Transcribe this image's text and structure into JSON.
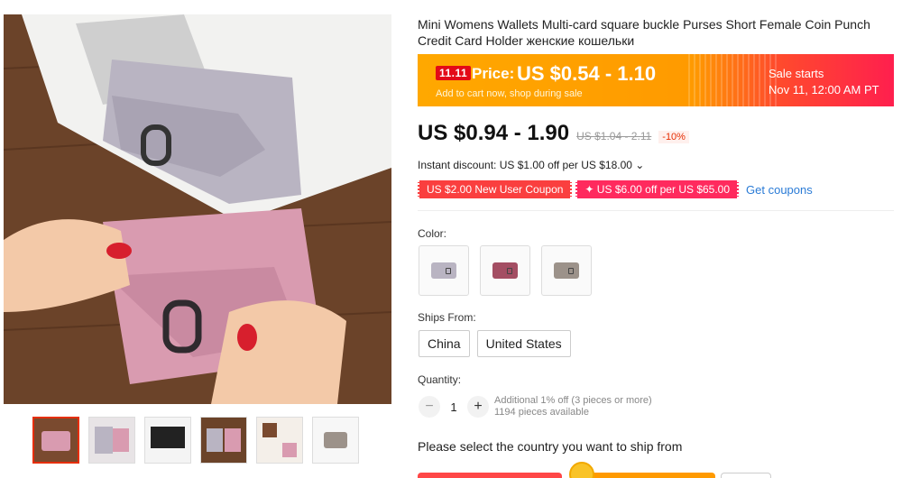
{
  "product": {
    "title": "Mini Womens Wallets Multi-card square buckle Purses Short Female Coin Punch Credit Card Holder женские кошельки"
  },
  "sale_banner": {
    "badge": "11.11",
    "price_label": "Price:",
    "price": "US $0.54 - 1.10",
    "subtext": "Add to cart now, shop during sale",
    "starts_label": "Sale starts",
    "starts_time": "Nov 11, 12:00 AM PT"
  },
  "pricing": {
    "price": "US $0.94 - 1.90",
    "old_price": "US $1.04 - 2.11",
    "discount": "-10%"
  },
  "instant_discount": "Instant discount: US $1.00 off per US $18.00 ⌄",
  "coupons": {
    "new_user": "US $2.00 New User Coupon",
    "off": "✦ US $6.00 off per US $65.00",
    "get": "Get coupons"
  },
  "color": {
    "label": "Color:",
    "options": [
      "gray-icon",
      "rose-icon",
      "taupe-icon"
    ]
  },
  "ships_from": {
    "label": "Ships From:",
    "options": [
      "China",
      "United States"
    ]
  },
  "quantity": {
    "label": "Quantity:",
    "value": "1",
    "note_line1": "Additional 1% off (3 pieces or more)",
    "note_line2": "1194 pieces available"
  },
  "ship_country": "Please select the country you want to ship from",
  "colors": {
    "accent": "#e62e04",
    "sale_orange": "#ffa800",
    "sale_red": "#ff1f4e",
    "link_blue": "#2a7bd6"
  }
}
